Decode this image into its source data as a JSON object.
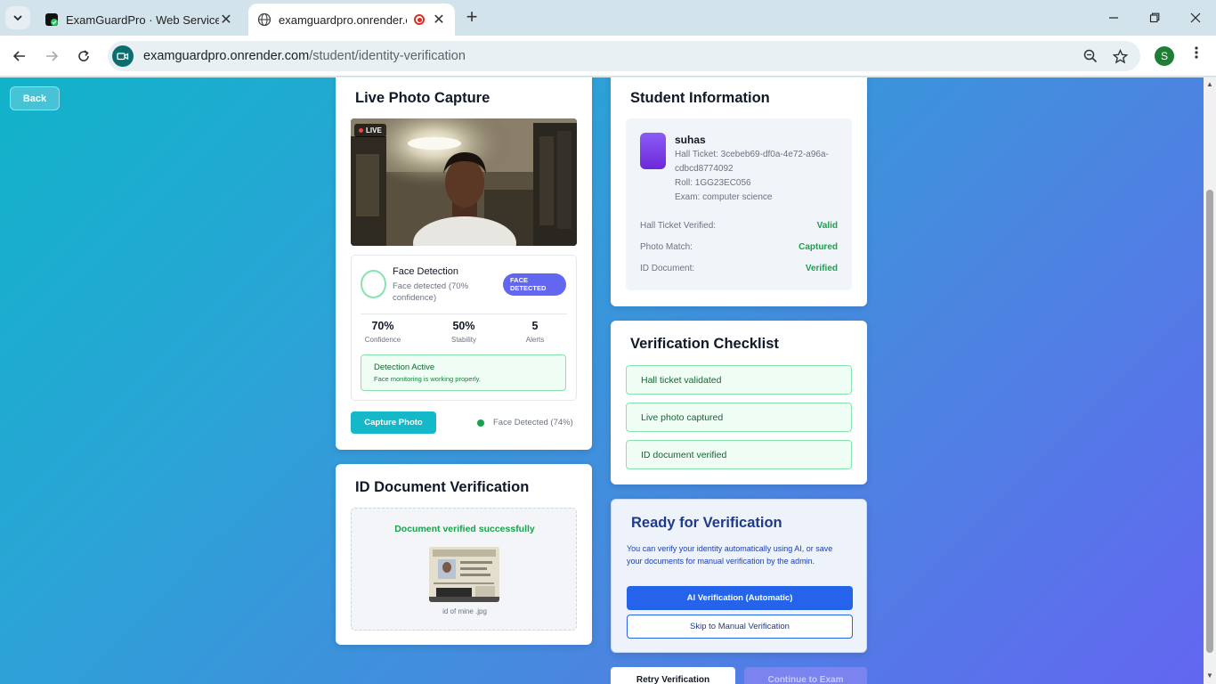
{
  "browser": {
    "tabs": [
      {
        "title": "ExamGuardPro · Web Service ·",
        "active": false
      },
      {
        "title": "examguardpro.onrender.com",
        "active": true
      }
    ],
    "url_host": "examguardpro.onrender.com",
    "url_path": "/student/identity-verification",
    "profile_initial": "S"
  },
  "page": {
    "back_label": "Back",
    "live": {
      "title": "Live Photo Capture",
      "live_badge": "LIVE",
      "face_detection": {
        "title": "Face Detection",
        "subtitle": "Face detected (70% confidence)",
        "pill": "FACE DETECTED",
        "stats": [
          {
            "value": "70%",
            "label": "Confidence"
          },
          {
            "value": "50%",
            "label": "Stability"
          },
          {
            "value": "5",
            "label": "Alerts"
          }
        ],
        "status_title": "Detection Active",
        "status_sub": "Face monitoring is working properly."
      },
      "capture_label": "Capture Photo",
      "capture_status": "Face Detected (74%)"
    },
    "id_doc": {
      "title": "ID Document Verification",
      "status": "Document verified successfully",
      "file_name": "id of mine .jpg"
    },
    "student": {
      "title": "Student Information",
      "name": "suhas",
      "hall_ticket": "Hall Ticket: 3cebeb69-df0a-4e72-a96a-cdbcd8774092",
      "roll": "Roll: 1GG23EC056",
      "exam": "Exam: computer science",
      "checks": [
        {
          "key": "Hall Ticket Verified:",
          "value": "Valid"
        },
        {
          "key": "Photo Match:",
          "value": "Captured"
        },
        {
          "key": "ID Document:",
          "value": "Verified"
        }
      ]
    },
    "checklist": {
      "title": "Verification Checklist",
      "items": [
        "Hall ticket validated",
        "Live photo captured",
        "ID document verified"
      ]
    },
    "ready": {
      "title": "Ready for Verification",
      "text": "You can verify your identity automatically using AI, or save your documents for manual verification by the admin.",
      "ai_label": "AI Verification (Automatic)",
      "manual_label": "Skip to Manual Verification"
    },
    "retry_label": "Retry Verification",
    "continue_label": "Continue to Exam"
  },
  "colors": {
    "accent": "#6366f1",
    "success": "#16a34a",
    "primary_button": "#2563eb",
    "capture_button": "#14b8c8"
  }
}
